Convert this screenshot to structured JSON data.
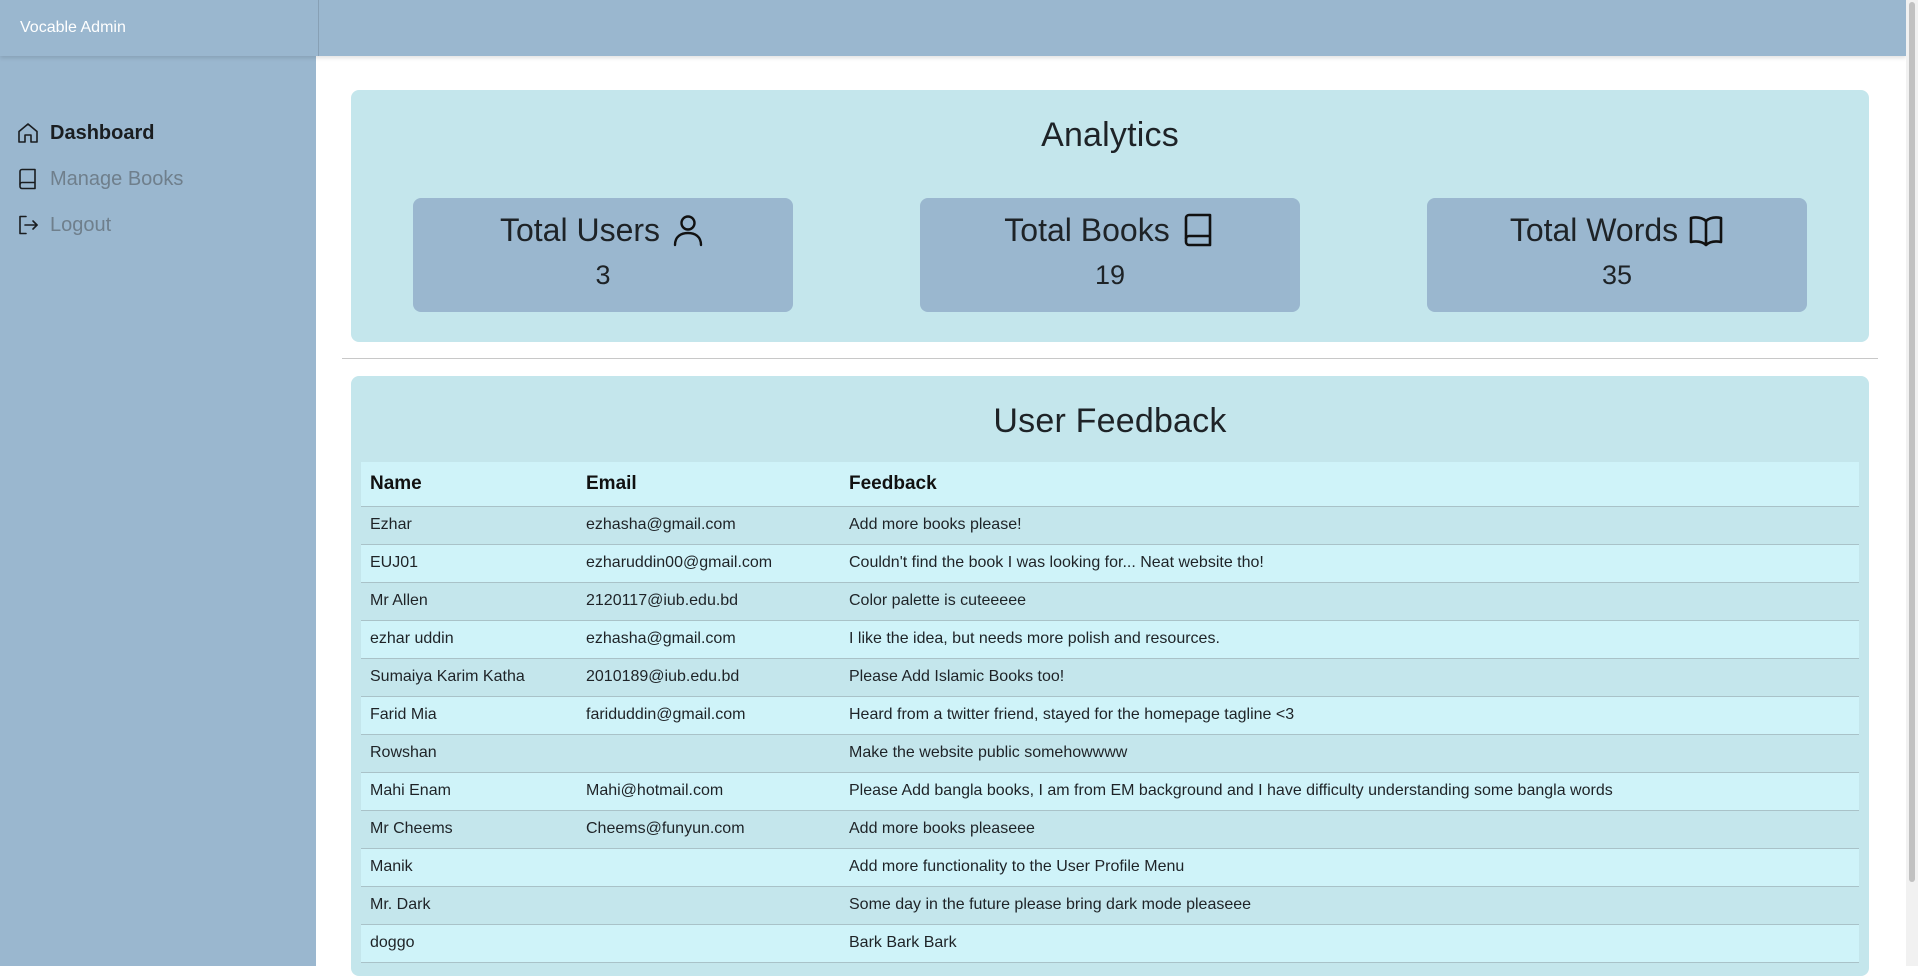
{
  "app": {
    "title": "Vocable Admin"
  },
  "sidebar": {
    "items": [
      {
        "label": "Dashboard",
        "icon": "home-icon",
        "active": true
      },
      {
        "label": "Manage Books",
        "icon": "book-icon",
        "active": false
      },
      {
        "label": "Logout",
        "icon": "logout-icon",
        "active": false
      }
    ]
  },
  "analytics": {
    "title": "Analytics",
    "stats": [
      {
        "label": "Total Users",
        "value": "3",
        "icon": "user-icon"
      },
      {
        "label": "Total Books",
        "value": "19",
        "icon": "book-icon"
      },
      {
        "label": "Total Words",
        "value": "35",
        "icon": "open-book-icon"
      }
    ]
  },
  "feedback": {
    "title": "User Feedback",
    "columns": [
      "Name",
      "Email",
      "Feedback"
    ],
    "rows": [
      {
        "name": "Ezhar",
        "email": "ezhasha@gmail.com",
        "feedback": "Add more books please!"
      },
      {
        "name": "EUJ01",
        "email": "ezharuddin00@gmail.com",
        "feedback": "Couldn't find the book I was looking for... Neat website tho!"
      },
      {
        "name": "Mr Allen",
        "email": "2120117@iub.edu.bd",
        "feedback": "Color palette is cuteeeee"
      },
      {
        "name": "ezhar uddin",
        "email": "ezhasha@gmail.com",
        "feedback": "I like the idea, but needs more polish and resources."
      },
      {
        "name": "Sumaiya Karim Katha",
        "email": "2010189@iub.edu.bd",
        "feedback": "Please Add Islamic Books too!"
      },
      {
        "name": "Farid Mia",
        "email": "fariduddin@gmail.com",
        "feedback": "Heard from a twitter friend, stayed for the homepage tagline <3"
      },
      {
        "name": "Rowshan",
        "email": "",
        "feedback": "Make the website public somehowwww"
      },
      {
        "name": "Mahi Enam",
        "email": "Mahi@hotmail.com",
        "feedback": "Please Add bangla books, I am from EM background and I have difficulty understanding some bangla words"
      },
      {
        "name": "Mr Cheems",
        "email": "Cheems@funyun.com",
        "feedback": "Add more books pleaseee"
      },
      {
        "name": "Manik",
        "email": "",
        "feedback": "Add more functionality to the User Profile Menu"
      },
      {
        "name": "Mr. Dark",
        "email": "",
        "feedback": "Some day in the future please bring dark mode pleaseee"
      },
      {
        "name": "doggo",
        "email": "",
        "feedback": "Bark Bark Bark"
      }
    ]
  },
  "colors": {
    "sidebar": "#9ab7cf",
    "card": "#c4e6ec",
    "row_alt": "#cff3f9",
    "stat_box": "#9ab7cf"
  }
}
